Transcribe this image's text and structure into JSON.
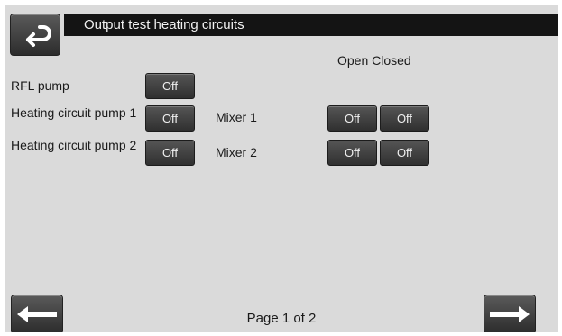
{
  "header": {
    "title": "Output test heating circuits",
    "back_icon": "return-arrow-icon"
  },
  "columns": {
    "open_closed": "Open Closed"
  },
  "rows": [
    {
      "label": "RFL pump",
      "state": "Off"
    },
    {
      "label": "Heating circuit pump 1",
      "state": "Off",
      "mixer_label": "Mixer 1",
      "mixer_open": "Off",
      "mixer_closed": "Off"
    },
    {
      "label": "Heating circuit pump 2",
      "state": "Off",
      "mixer_label": "Mixer 2",
      "mixer_open": "Off",
      "mixer_closed": "Off"
    }
  ],
  "footer": {
    "page_text": "Page 1 of 2",
    "prev_icon": "arrow-left-icon",
    "next_icon": "arrow-right-icon"
  }
}
